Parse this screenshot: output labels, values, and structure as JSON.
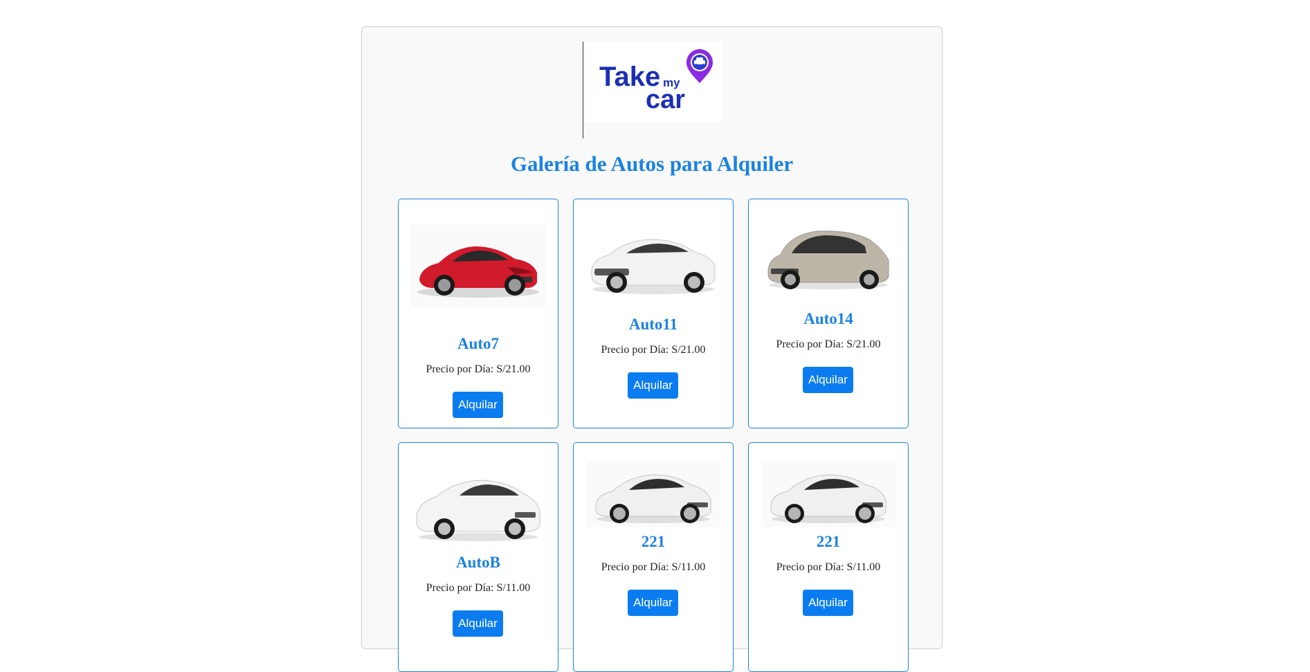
{
  "logo": {
    "line1": "Take",
    "line2": "my",
    "line3": "car"
  },
  "page_title": "Galería de Autos para Alquiler",
  "colors": {
    "accent": "#1a82e2",
    "button": "#0a7cf0",
    "logo_text": "#1c2fb5",
    "logo_pin": "#8a2be2"
  },
  "cars": [
    {
      "name": "Auto7",
      "price": "Precio por Día: S/21.00",
      "button": "Alquilar",
      "image": "red-sports-car"
    },
    {
      "name": "Auto11",
      "price": "Precio por Día: S/21.00",
      "button": "Alquilar",
      "image": "white-sedan"
    },
    {
      "name": "Auto14",
      "price": "Precio por Día: S/21.00",
      "button": "Alquilar",
      "image": "grey-hatchback"
    },
    {
      "name": "AutoB",
      "price": "Precio por Día: S/11.00",
      "button": "Alquilar",
      "image": "white-hatchback"
    },
    {
      "name": "221",
      "price": "Precio por Día: S/11.00",
      "button": "Alquilar",
      "image": "silver-coupe"
    },
    {
      "name": "221",
      "price": "Precio por Día: S/11.00",
      "button": "Alquilar",
      "image": "silver-coupe"
    }
  ]
}
